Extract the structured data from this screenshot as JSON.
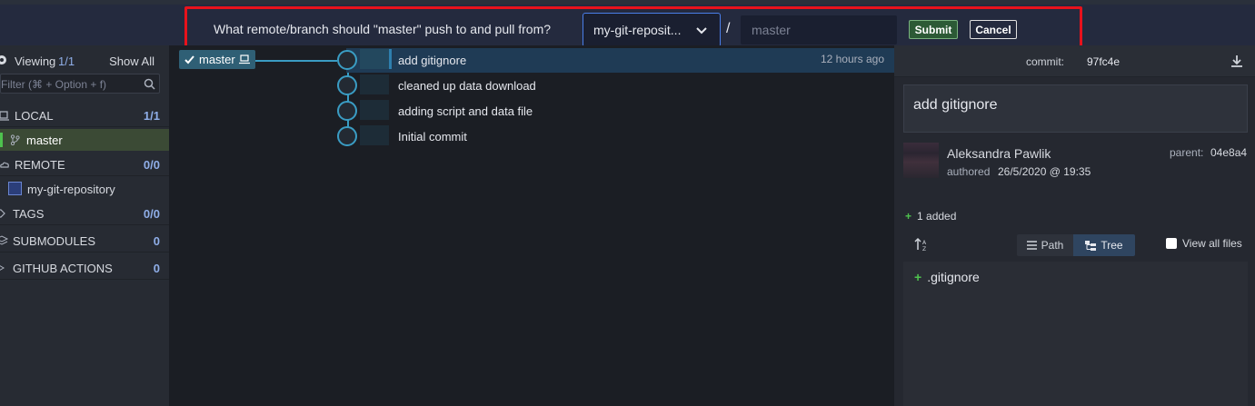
{
  "dialog": {
    "prompt": "What remote/branch should \"master\" push to and pull from?",
    "remote_selected": "my-git-reposit...",
    "separator": "/",
    "branch_placeholder": "master",
    "submit_label": "Submit",
    "cancel_label": "Cancel"
  },
  "sidebar": {
    "viewing_label": "Viewing",
    "viewing_count": "1/1",
    "show_all": "Show All",
    "filter_placeholder": "Filter (⌘ + Option + f)",
    "local": {
      "label": "LOCAL",
      "count": "1/1"
    },
    "local_branch": "master",
    "remote": {
      "label": "REMOTE",
      "count": "0/0"
    },
    "remote_repo": "my-git-repository",
    "tags": {
      "label": "TAGS",
      "count": "0/0"
    },
    "submodules": {
      "label": "SUBMODULES",
      "count": "0"
    },
    "github_actions": {
      "label": "GITHUB ACTIONS",
      "count": "0"
    }
  },
  "graph": {
    "branch_tag": "master",
    "commits": [
      {
        "message": "add gitignore",
        "time": "12 hours ago"
      },
      {
        "message": "cleaned up data download",
        "time": ""
      },
      {
        "message": "adding script and data file",
        "time": ""
      },
      {
        "message": "Initial commit",
        "time": ""
      }
    ]
  },
  "panel": {
    "commit_label": "commit:",
    "commit_sha": "97fc4e",
    "summary": "add gitignore",
    "author": "Aleksandra Pawlik",
    "authored_label": "authored",
    "authored_date": "26/5/2020 @ 19:35",
    "parent_label": "parent:",
    "parent_sha": "04e8a4",
    "added_summary": "1 added",
    "path_label": "Path",
    "tree_label": "Tree",
    "view_all_label": "View all files",
    "files": [
      ".gitignore"
    ]
  },
  "colors": {
    "accent_blue": "#3a9cc3",
    "highlight_red": "#e8121c",
    "added_green": "#4ec24e"
  }
}
